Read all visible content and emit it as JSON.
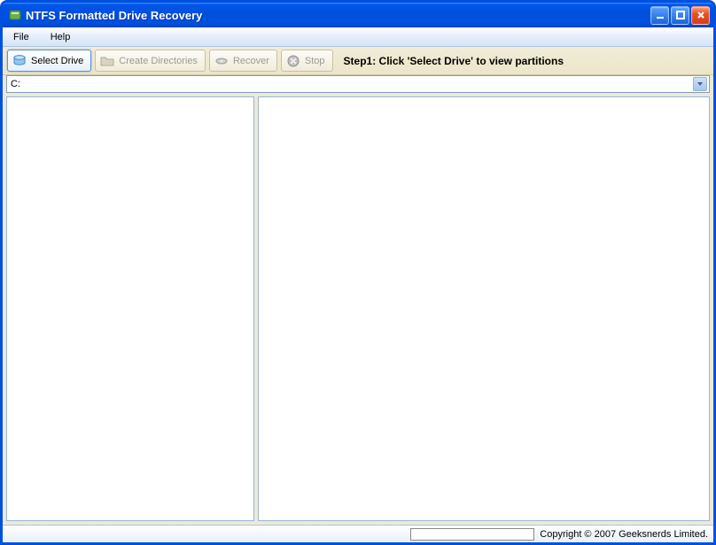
{
  "window": {
    "title": "NTFS Formatted Drive Recovery"
  },
  "menu": {
    "file": "File",
    "help": "Help"
  },
  "toolbar": {
    "select_drive": "Select Drive",
    "create_directories": "Create Directories",
    "recover": "Recover",
    "stop": "Stop"
  },
  "step_text": "Step1: Click 'Select Drive' to view partitions",
  "drive_dropdown": {
    "value": "C:"
  },
  "status": {
    "copyright": "Copyright © 2007 Geeksnerds Limited."
  },
  "icons": {
    "db": "db",
    "folder": "folder",
    "disk": "disk",
    "stop": "stop"
  }
}
